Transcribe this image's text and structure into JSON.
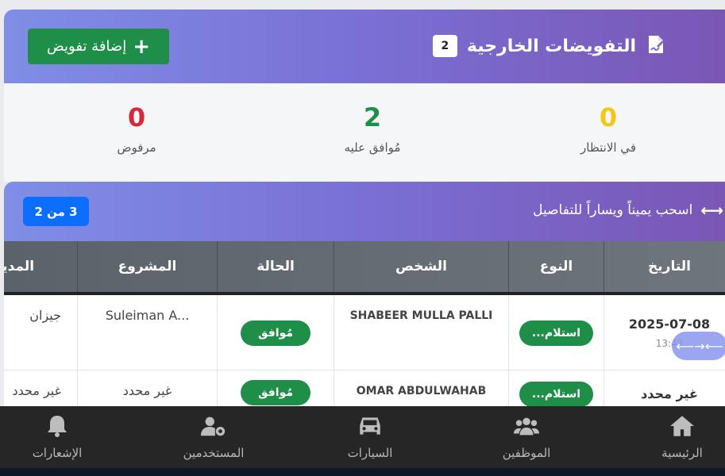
{
  "header": {
    "title": "التفويضات الخارجية",
    "count": "2",
    "add_button": "إضافة تفويض"
  },
  "stats": {
    "pending": {
      "value": "0",
      "label": "في الانتظار",
      "color": "#f5c518"
    },
    "approved": {
      "value": "2",
      "label": "مُوافق عليه",
      "color": "#1e8e48"
    },
    "rejected": {
      "value": "0",
      "label": "مرفوض",
      "color": "#d9263a"
    }
  },
  "table_bar": {
    "hint": "اسحب يميناً ويساراً للتفاصيل",
    "page": "3 من 2"
  },
  "table": {
    "headers": [
      "التاريخ",
      "النوع",
      "الشخص",
      "الحالة",
      "المشروع",
      "المدينة"
    ],
    "rows": [
      {
        "date": "2025-07-08",
        "time": "13:43",
        "type": "استلام...",
        "person": "SHABEER MULLA PALLI",
        "status": "مُوافق",
        "project": "Suleiman A...",
        "city": "جيزان"
      },
      {
        "date": "غير محدد",
        "time": "",
        "type": "استلام...",
        "person": "OMAR ABDULWAHAB",
        "status": "مُوافق",
        "project": "غير محدد",
        "city": "غير محدد"
      }
    ]
  },
  "swipe_indicator": "⟵→⟵",
  "nav": [
    {
      "label": "الرئيسية",
      "icon": "home-icon"
    },
    {
      "label": "الموظفين",
      "icon": "users-icon"
    },
    {
      "label": "السيارات",
      "icon": "car-icon"
    },
    {
      "label": "المستخدمين",
      "icon": "user-gear-icon"
    },
    {
      "label": "الإشعارات",
      "icon": "bell-icon"
    }
  ]
}
